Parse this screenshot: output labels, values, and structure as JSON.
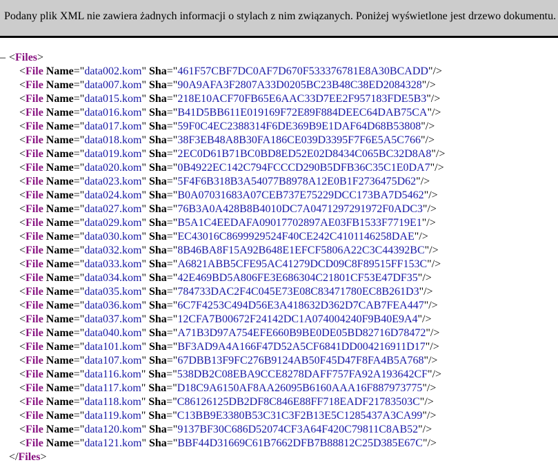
{
  "notice": "Podany plik XML nie zawiera żadnych informacji o stylach z nim związanych. Poniżej wyświetlone jest drzewo dokumentu.",
  "toggle_symbol": "–",
  "root_tag": "Files",
  "element_tag": "File",
  "attr_name_label": "Name",
  "attr_sha_label": "Sha",
  "colors": {
    "notice_background": "#cccccc",
    "tag": "#881280",
    "attribute_value": "#1a1aa6"
  },
  "files": [
    {
      "name": "data002.kom",
      "sha": "461F57CBF7DC0AF7D670F533376781E8A30BCADD"
    },
    {
      "name": "data007.kom",
      "sha": "90A9AFA3F2807A33D0205BC23B48C38ED2084328"
    },
    {
      "name": "data015.kom",
      "sha": "218E10ACF70FB65E6AAC33D7EE2F957183FDE5B3"
    },
    {
      "name": "data016.kom",
      "sha": "B41D5BB611E019169F72E89F884DEEC64DAB75CA"
    },
    {
      "name": "data017.kom",
      "sha": "59F0C4EC2388314F6DE369B9E1DAF64D68B53808"
    },
    {
      "name": "data018.kom",
      "sha": "38F3EB48A8B30FA186CE039D3395F7F6E5A5C766"
    },
    {
      "name": "data019.kom",
      "sha": "2EC0D61B71BC0BD8ED52E02D8434C065BC32D8A8"
    },
    {
      "name": "data020.kom",
      "sha": "0B4922EC142C794FCCCD290B5DFB36C35C1E0DA7"
    },
    {
      "name": "data023.kom",
      "sha": "5F4F6B318B3A54077B8978A12E0B1F2736475D62"
    },
    {
      "name": "data024.kom",
      "sha": "B0A07031683A07CEB737E75229DCC173BA7D5462"
    },
    {
      "name": "data027.kom",
      "sha": "76B3A0A428B8B4010DC7A0471297291972F0ADC3"
    },
    {
      "name": "data029.kom",
      "sha": "B5A1C4EEDAFA09017702897AE03FB1533F7719E1"
    },
    {
      "name": "data030.kom",
      "sha": "EC43016C8699929524F40CE242C4101146258DAE"
    },
    {
      "name": "data032.kom",
      "sha": "8B46BA8F15A92B648E1EFCF5806A22C3C44392BC"
    },
    {
      "name": "data033.kom",
      "sha": "A6821ABB5CFE95AC41279DCD09C8F89515FF153C"
    },
    {
      "name": "data034.kom",
      "sha": "42E469BD5A806FE3E686304C21801CF53E47DF35"
    },
    {
      "name": "data035.kom",
      "sha": "784733DAC2F4C045E73E08C83471780EC8B261D3"
    },
    {
      "name": "data036.kom",
      "sha": "6C7F4253C494D56E3A418632D362D7CAB7FEA447"
    },
    {
      "name": "data037.kom",
      "sha": "12CFA7B00672F24142DC1A074004240F9B40E9A4"
    },
    {
      "name": "data040.kom",
      "sha": "A71B3D97A754EFE660B9BE0DE05BD82716D78472"
    },
    {
      "name": "data101.kom",
      "sha": "BF3AD9A4A166F47D52A5CF6841DD004216911D17"
    },
    {
      "name": "data107.kom",
      "sha": "67DBB13F9FC276B9124AB50F45D47F8FA4B5A768"
    },
    {
      "name": "data116.kom",
      "sha": "538DB2C08EBA9CCE8278DAFF757FA92A193642CF"
    },
    {
      "name": "data117.kom",
      "sha": "D18C9A6150AF8AA26095B6160AAA16F887973775"
    },
    {
      "name": "data118.kom",
      "sha": "C86126125DB2DF8C846E88FF718EADF21783503C"
    },
    {
      "name": "data119.kom",
      "sha": "C13BB9E3380B53C31C3F2B13E5C1285437A3CA99"
    },
    {
      "name": "data120.kom",
      "sha": "9137BF30C686D52074CF3A64F420C79811C8AB52"
    },
    {
      "name": "data121.kom",
      "sha": "BBF44D31669C61B7662DFB7B88812C25D385E67C"
    }
  ]
}
